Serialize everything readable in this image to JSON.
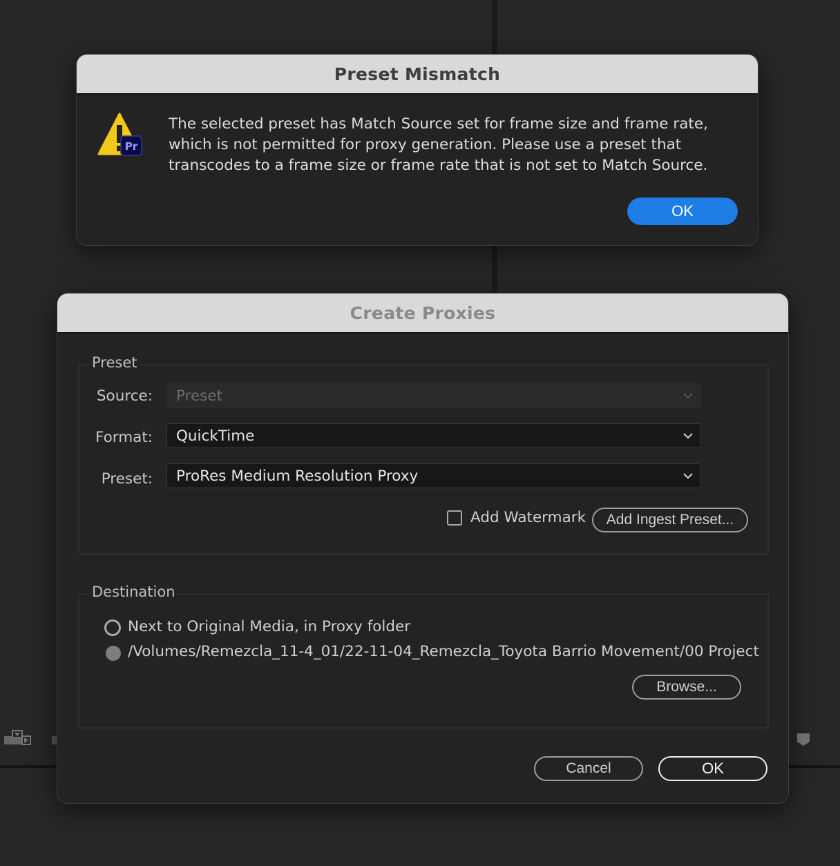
{
  "mismatch_dialog": {
    "title": "Preset Mismatch",
    "icon": "warning-icon",
    "badge": "Pr",
    "message": "The selected preset has Match Source set for frame size and frame rate, which is not permitted for proxy generation. Please use a preset that transcodes to a frame size or frame rate that is not set to Match Source.",
    "ok_label": "OK",
    "colors": {
      "accent": "#1f7ee6",
      "warning": "#f4c81a",
      "badge_bg": "#0c0b4a",
      "badge_text": "#9999ff"
    }
  },
  "proxies_dialog": {
    "title": "Create Proxies",
    "preset_group": {
      "label": "Preset",
      "source_label": "Source:",
      "source_value": "Preset",
      "format_label": "Format:",
      "format_value": "QuickTime",
      "preset_label": "Preset:",
      "preset_value": "ProRes Medium Resolution Proxy",
      "watermark_label": "Add Watermark",
      "watermark_checked": false,
      "ingest_button": "Add Ingest Preset..."
    },
    "destination_group": {
      "label": "Destination",
      "option_1": "Next to Original Media, in Proxy folder",
      "option_2": "/Volumes/Remezcla_11-4_01/22-11-04_Remezcla_Toyota Barrio Movement/00 Project",
      "selected": 2,
      "browse_button": "Browse..."
    },
    "cancel_label": "Cancel",
    "ok_label": "OK"
  }
}
